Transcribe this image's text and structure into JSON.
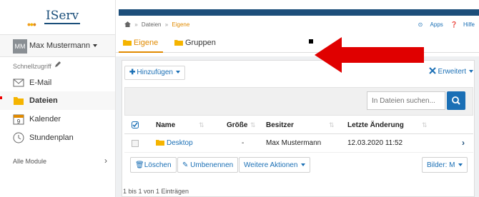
{
  "sidebar": {
    "logo_text": "IServ",
    "user": {
      "initials": "MM",
      "name": "Max Mustermann"
    },
    "quick_access_label": "Schnellzugriff",
    "items": [
      {
        "label": "E-Mail",
        "icon": "mail-icon"
      },
      {
        "label": "Dateien",
        "icon": "folder-icon",
        "active": true
      },
      {
        "label": "Kalender",
        "icon": "calendar-icon",
        "calendar_day": "9"
      },
      {
        "label": "Stundenplan",
        "icon": "clock-icon"
      }
    ],
    "all_modules_label": "Alle Module"
  },
  "breadcrumb": {
    "items": [
      "Dateien",
      "Eigene"
    ],
    "separator": "»"
  },
  "top_links": {
    "apps": "Apps",
    "help": "Hilfe"
  },
  "tabs": [
    {
      "label": "Eigene",
      "active": true
    },
    {
      "label": "Gruppen"
    }
  ],
  "toolbar": {
    "add_label": "Hinzufügen",
    "advanced_label": "Erweitert"
  },
  "search": {
    "placeholder": "In Dateien suchen..."
  },
  "table": {
    "headers": [
      "Name",
      "Größe",
      "Besitzer",
      "Letzte Änderung"
    ],
    "rows": [
      {
        "name": "Desktop",
        "size": "-",
        "owner": "Max Mustermann",
        "modified": "12.03.2020 11:52"
      }
    ]
  },
  "actions": {
    "delete": "Löschen",
    "rename": "Umbenennen",
    "more": "Weitere Aktionen",
    "images": "Bilder: M"
  },
  "footer": {
    "entries_text": "1 bis 1 von 1 Einträgen"
  },
  "colors": {
    "brand_dark": "#1d4e7a",
    "accent_orange": "#e08a00",
    "link_blue": "#1a6fb5",
    "annotation_red": "#e00000"
  }
}
